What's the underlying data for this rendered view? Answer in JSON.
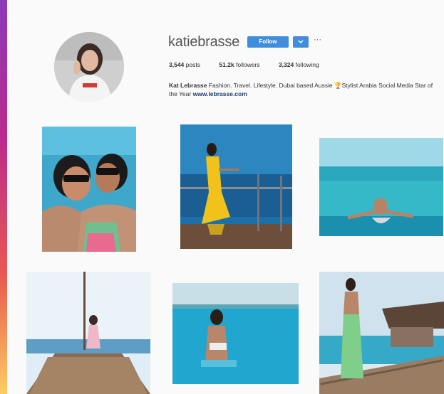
{
  "profile": {
    "username": "katiebrasse",
    "follow_label": "Follow",
    "more_label": "···",
    "stats": {
      "posts_count": "3,544",
      "posts_label": "posts",
      "followers_count": "51.2k",
      "followers_label": "followers",
      "following_count": "3,324",
      "following_label": "following"
    },
    "bio": {
      "name": "Kat Lebrasse",
      "text": "Fashion. Travel. Lifestyle. Dubai based Aussie 🏆Stylist Arabia Social Media Star of the Year ",
      "link": "www.lebrasse.com"
    }
  },
  "colors": {
    "follow_button": "#3f8ddb",
    "brand_gradient": [
      "#8a3ab9",
      "#bc2a8d",
      "#e95950",
      "#fccc63"
    ]
  },
  "icons": {
    "dropdown": "chevron-down-icon",
    "more": "more-options-icon"
  },
  "grid": {
    "posts": [
      {
        "scene": "selfie-two-women"
      },
      {
        "scene": "yellow-dress-railing"
      },
      {
        "scene": "swimming-pool-sea"
      },
      {
        "scene": "boat-deck"
      },
      {
        "scene": "standing-in-water"
      },
      {
        "scene": "pier-overwater-villa"
      }
    ]
  }
}
